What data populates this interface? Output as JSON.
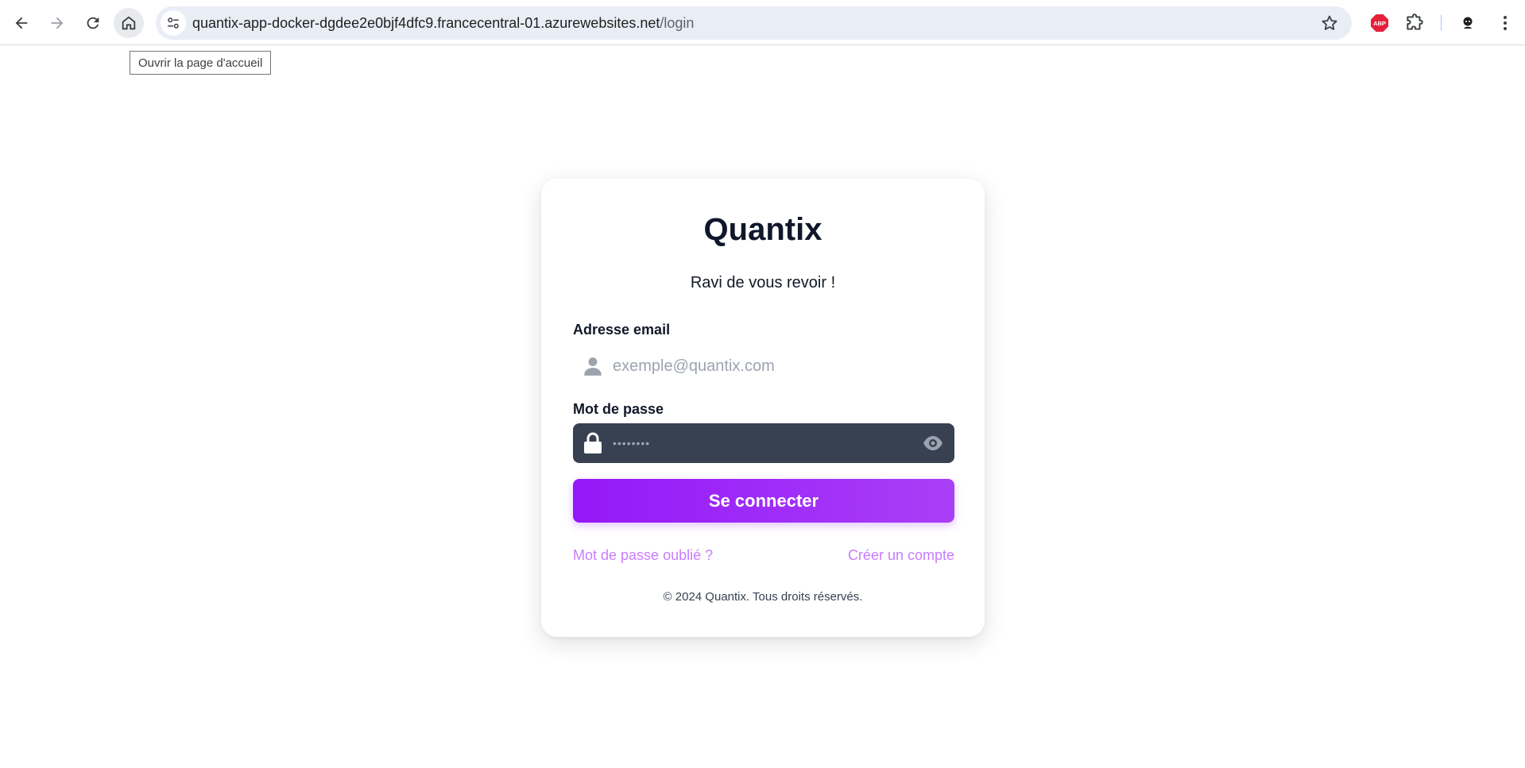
{
  "browser": {
    "url_host": "quantix-app-docker-dgdee2e0bjf4dfc9.francecentral-01.azurewebsites.net",
    "url_path": "/login",
    "tooltip": "Ouvrir la page d'accueil",
    "extension_badge": "ABP",
    "icons": [
      "back-arrow-icon",
      "forward-arrow-icon",
      "reload-icon",
      "home-icon",
      "site-info-icon",
      "star-icon",
      "adblock-icon",
      "extensions-icon",
      "profile-icon",
      "kebab-menu-icon"
    ]
  },
  "login": {
    "brand": "Quantix",
    "welcome": "Ravi de vous revoir !",
    "email_label": "Adresse email",
    "email_placeholder": "exemple@quantix.com",
    "password_label": "Mot de passe",
    "password_mask": "••••••••",
    "submit_label": "Se connecter",
    "forgot_link": "Mot de passe oublié ?",
    "create_link": "Créer un compte",
    "copyright": "© 2024 Quantix. Tous droits réservés."
  },
  "colors": {
    "accent": "#9418f8",
    "link": "#c77dff",
    "password_field_bg": "#374151",
    "omnibox_bg": "#e9eef6"
  }
}
